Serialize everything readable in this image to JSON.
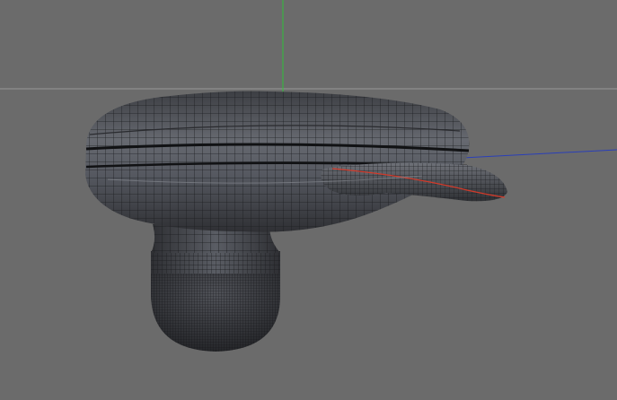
{
  "viewport": {
    "background": "#6b6b6b",
    "axes": {
      "x_color": "#2a3fb8",
      "y_color": "#2fbf3a",
      "horizon_color": "#9a9a9a"
    },
    "object": {
      "surface_color": "#4a4c52",
      "highlight_color": "#7b7e86",
      "wire_color": "#1a1b1e",
      "selection_edge_color": "#d23a2a",
      "display_mode": "wireframe-shaded"
    }
  }
}
